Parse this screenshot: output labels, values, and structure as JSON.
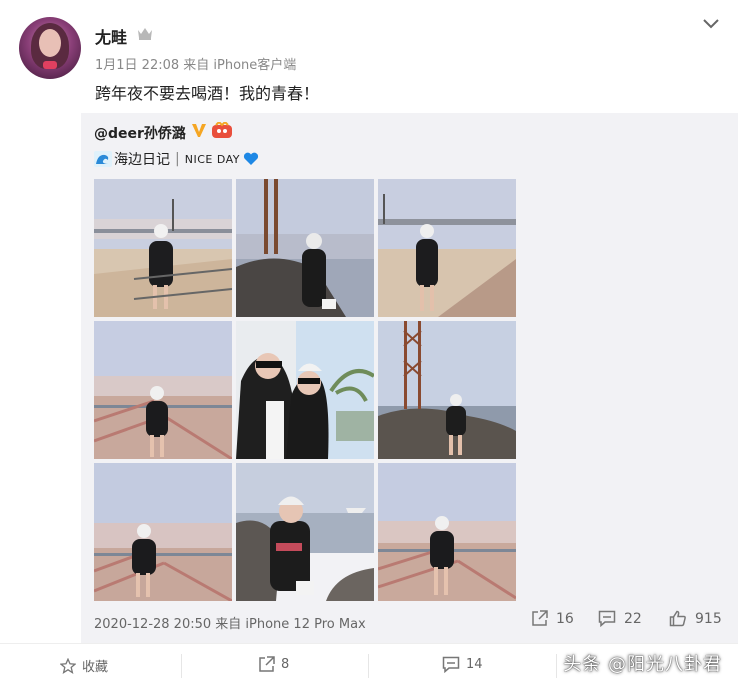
{
  "post": {
    "username": "尢畦",
    "meta": "1月1日 22:08 来自 iPhone客户端",
    "text": "跨年夜不要去喝酒！我的青春！"
  },
  "repost": {
    "author": "@deer孙侨潞",
    "text_main": "海边日记",
    "text_sep": "|",
    "text_nice": "NICE DAY",
    "footer": "2020-12-28 20:50 来自 iPhone 12 Pro Max",
    "stats": {
      "reposts": "16",
      "comments": "22",
      "likes": "915"
    }
  },
  "actions": {
    "favorite": "收藏",
    "repost": "8",
    "comment": "14"
  },
  "watermark": "头条 @阳光八卦君",
  "colors": {
    "accent": "#ff8200",
    "vip": "#f5a623",
    "heart": "#1e88e5"
  }
}
